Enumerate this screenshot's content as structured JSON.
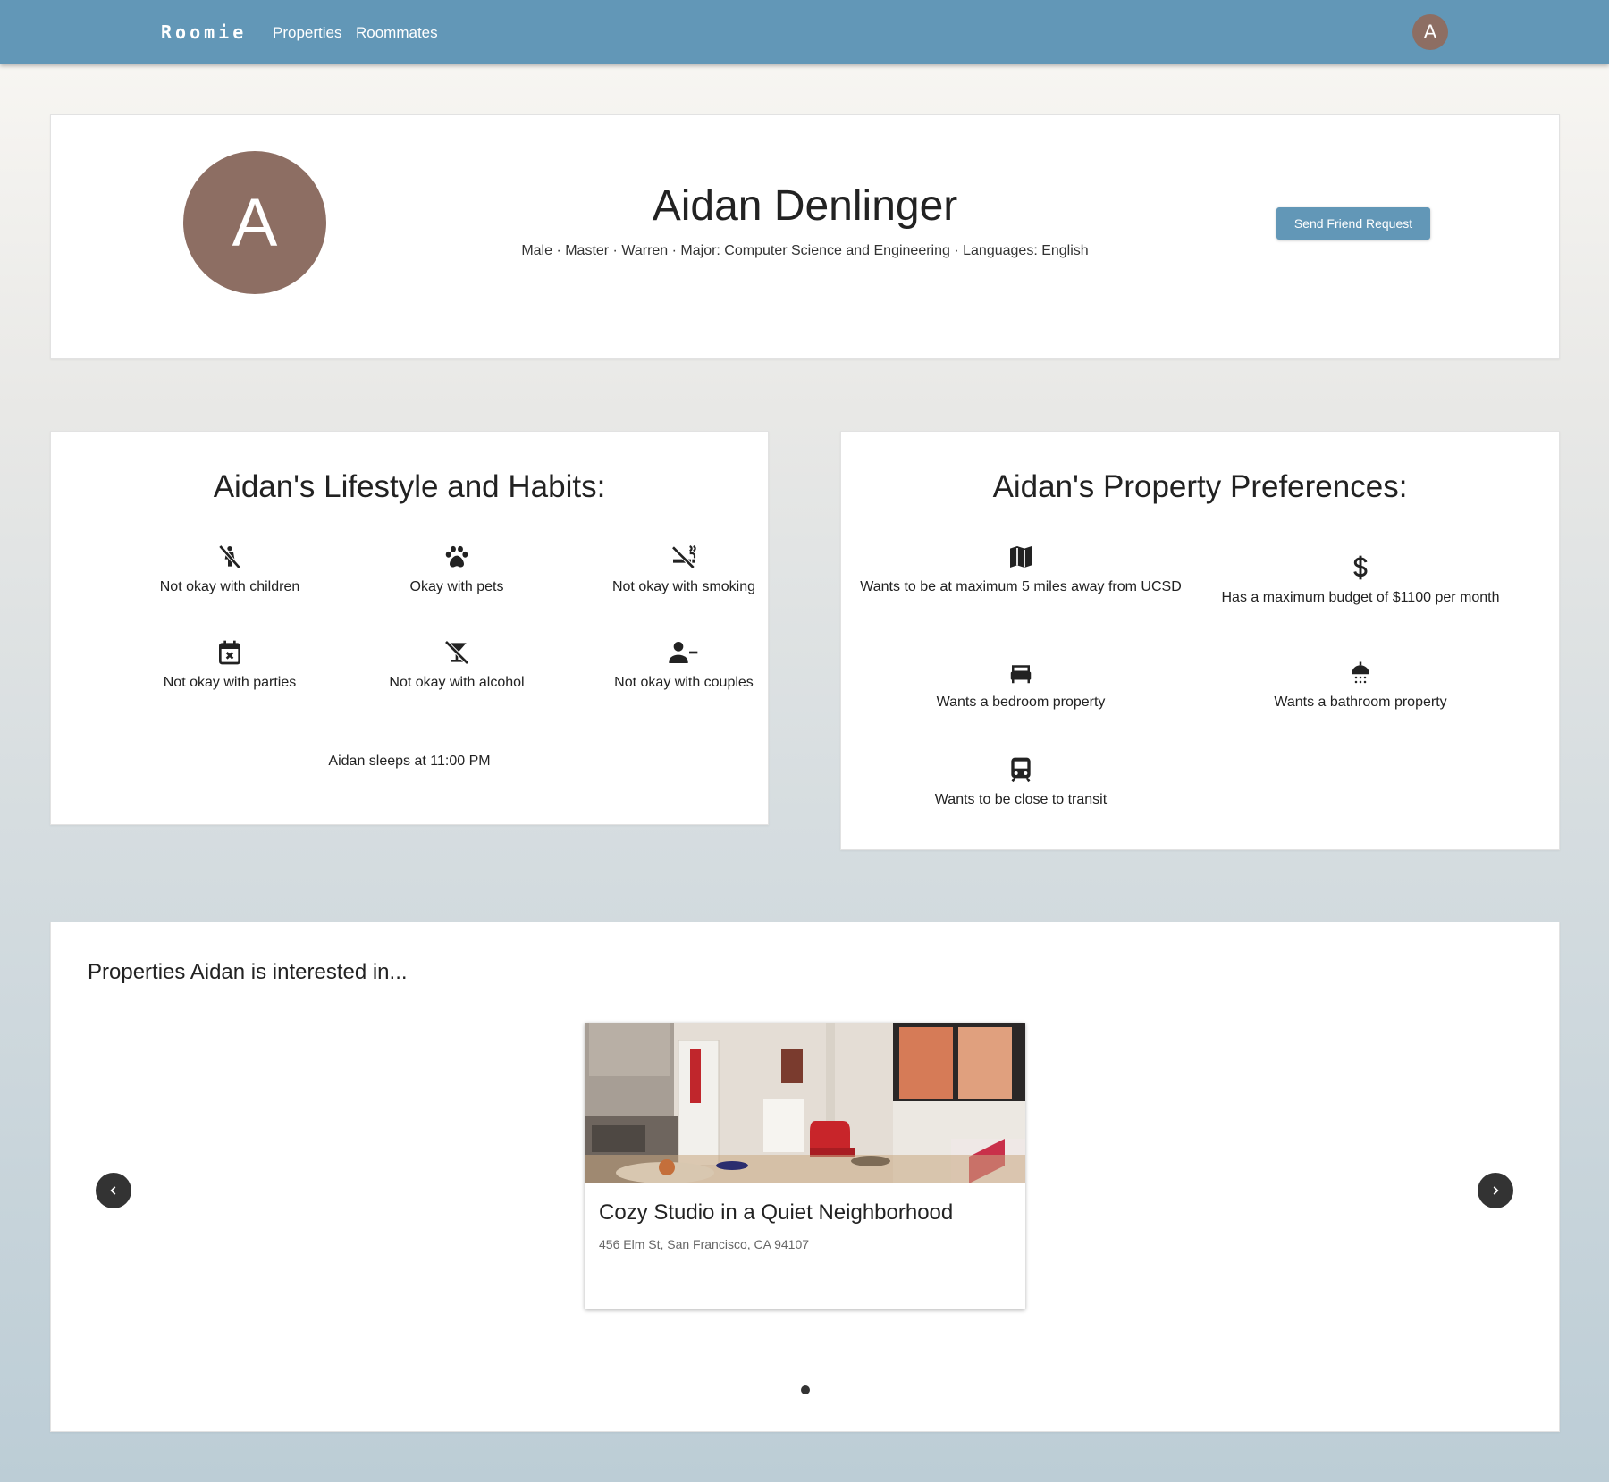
{
  "nav": {
    "brand": "Roomie",
    "links": [
      {
        "label": "Properties"
      },
      {
        "label": "Roommates"
      }
    ],
    "avatar_initial": "A"
  },
  "profile": {
    "avatar_initial": "A",
    "name": "Aidan Denlinger",
    "meta": "Male · Master · Warren · Major: Computer Science and Engineering · Languages: English",
    "friend_button": "Send Friend Request"
  },
  "lifestyle": {
    "title": "Aidan's Lifestyle and Habits:",
    "items": [
      {
        "icon": "no-children-icon",
        "label": "Not okay with children"
      },
      {
        "icon": "paw-icon",
        "label": "Okay with pets"
      },
      {
        "icon": "no-smoking-icon",
        "label": "Not okay with smoking"
      },
      {
        "icon": "calendar-x-icon",
        "label": "Not okay with parties"
      },
      {
        "icon": "no-alcohol-icon",
        "label": "Not okay with alcohol"
      },
      {
        "icon": "person-remove-icon",
        "label": "Not okay with couples"
      }
    ],
    "sleep": "Aidan sleeps at 11:00 PM"
  },
  "preferences": {
    "title": "Aidan's Property Preferences:",
    "items": [
      {
        "icon": "map-icon",
        "label": "Wants to be at maximum 5 miles away from UCSD"
      },
      {
        "icon": "dollar-icon",
        "label": "Has a maximum budget of $1100 per month"
      },
      {
        "icon": "bed-icon",
        "label": "Wants a bedroom property"
      },
      {
        "icon": "shower-icon",
        "label": "Wants a bathroom property"
      },
      {
        "icon": "train-icon",
        "label": "Wants to be close to transit"
      }
    ]
  },
  "interested": {
    "title": "Properties Aidan is interested in...",
    "properties": [
      {
        "title": "Cozy Studio in a Quiet Neighborhood",
        "address": "456 Elm St, San Francisco, CA 94107"
      }
    ]
  },
  "colors": {
    "primary": "#6297b7",
    "avatar": "#8d6e63",
    "arrow": "#333333"
  }
}
